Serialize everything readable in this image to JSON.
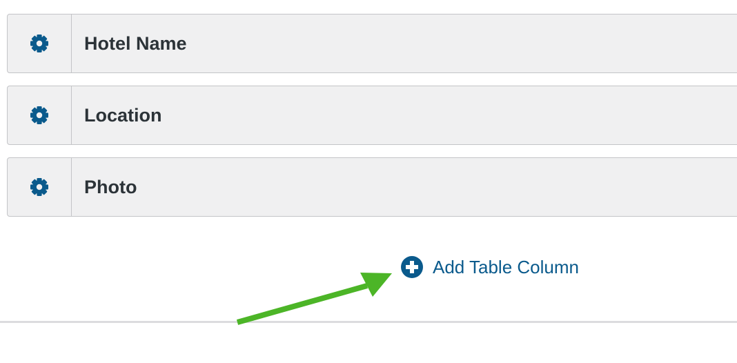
{
  "columns": [
    {
      "label": "Hotel Name",
      "settings_icon": "gear-icon"
    },
    {
      "label": "Location",
      "settings_icon": "gear-icon"
    },
    {
      "label": "Photo",
      "settings_icon": "gear-icon"
    }
  ],
  "add_column": {
    "label": "Add Table Column",
    "icon": "plus-circle-icon"
  },
  "colors": {
    "accent": "#0a5a8c",
    "row_background": "#f0f0f1",
    "row_border": "#c3c4c7",
    "label_text": "#2c3338",
    "annotation_arrow": "#4cb527"
  }
}
